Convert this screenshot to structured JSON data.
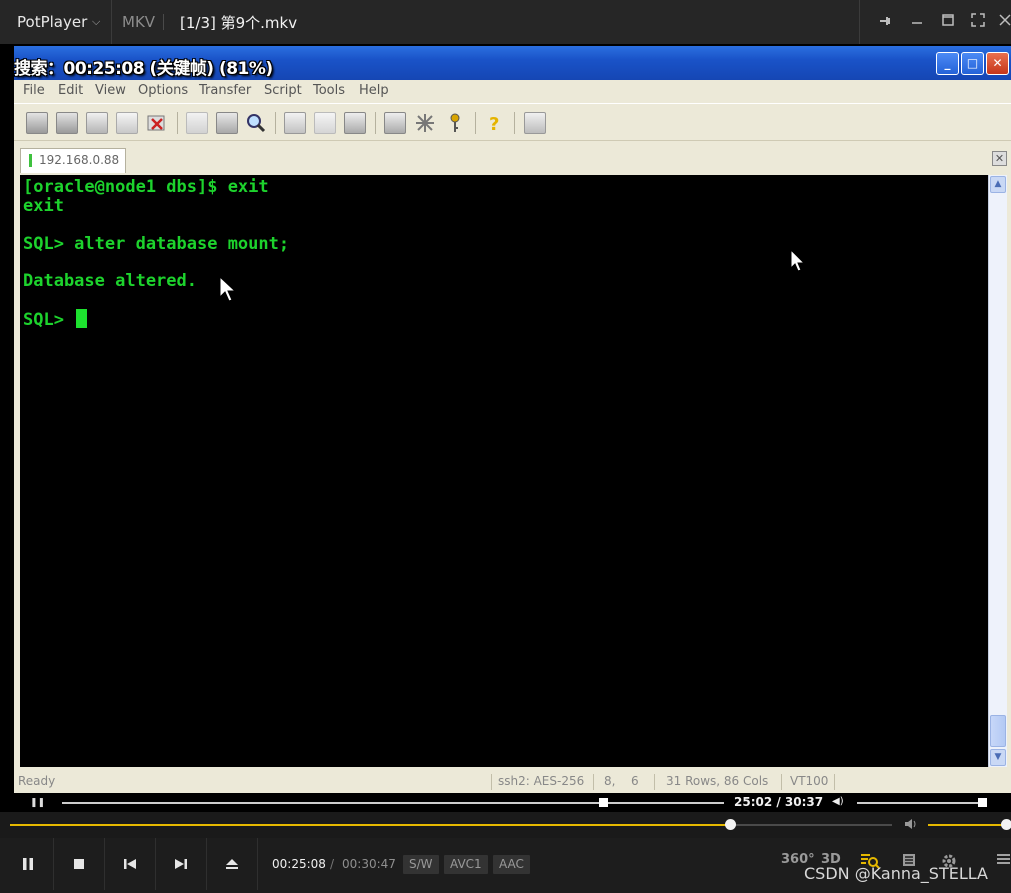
{
  "player": {
    "brand": "PotPlayer",
    "format": "MKV",
    "filename": "[1/3] 第9个.mkv"
  },
  "osd": {
    "text": "搜索：00:25:08 (关键帧) (81%)"
  },
  "securecrt": {
    "menu": [
      "File",
      "Edit",
      "View",
      "Options",
      "Transfer",
      "Script",
      "Tools",
      "Help"
    ],
    "tab_label": "192.168.0.88",
    "terminal_lines": [
      "[oracle@node1 dbs]$ exit",
      "exit",
      "",
      "SQL> alter database mount;",
      "",
      "Database altered.",
      "",
      "SQL> "
    ],
    "status": {
      "ready": "Ready",
      "protocol": "ssh2: AES-256",
      "cursor_row": "8,",
      "cursor_col": "6",
      "size": "31 Rows,  86 Cols",
      "term_type": "VT100"
    },
    "colors": {
      "terminal_text": "#1dd32d",
      "terminal_bg": "#000000"
    }
  },
  "video_controls": {
    "time": "25:02 / 30:37",
    "progress": 0.817
  },
  "playback": {
    "current_time": "00:25:08",
    "separator": "/",
    "total_time": "00:30:47",
    "progress": 0.816,
    "volume": 1.0,
    "badges": [
      "S/W",
      "AVC1",
      "AAC"
    ],
    "right_icons": [
      "360°",
      "3D"
    ],
    "accent_color": "#e5b800"
  },
  "watermark": "CSDN @Kanna_STELLA"
}
